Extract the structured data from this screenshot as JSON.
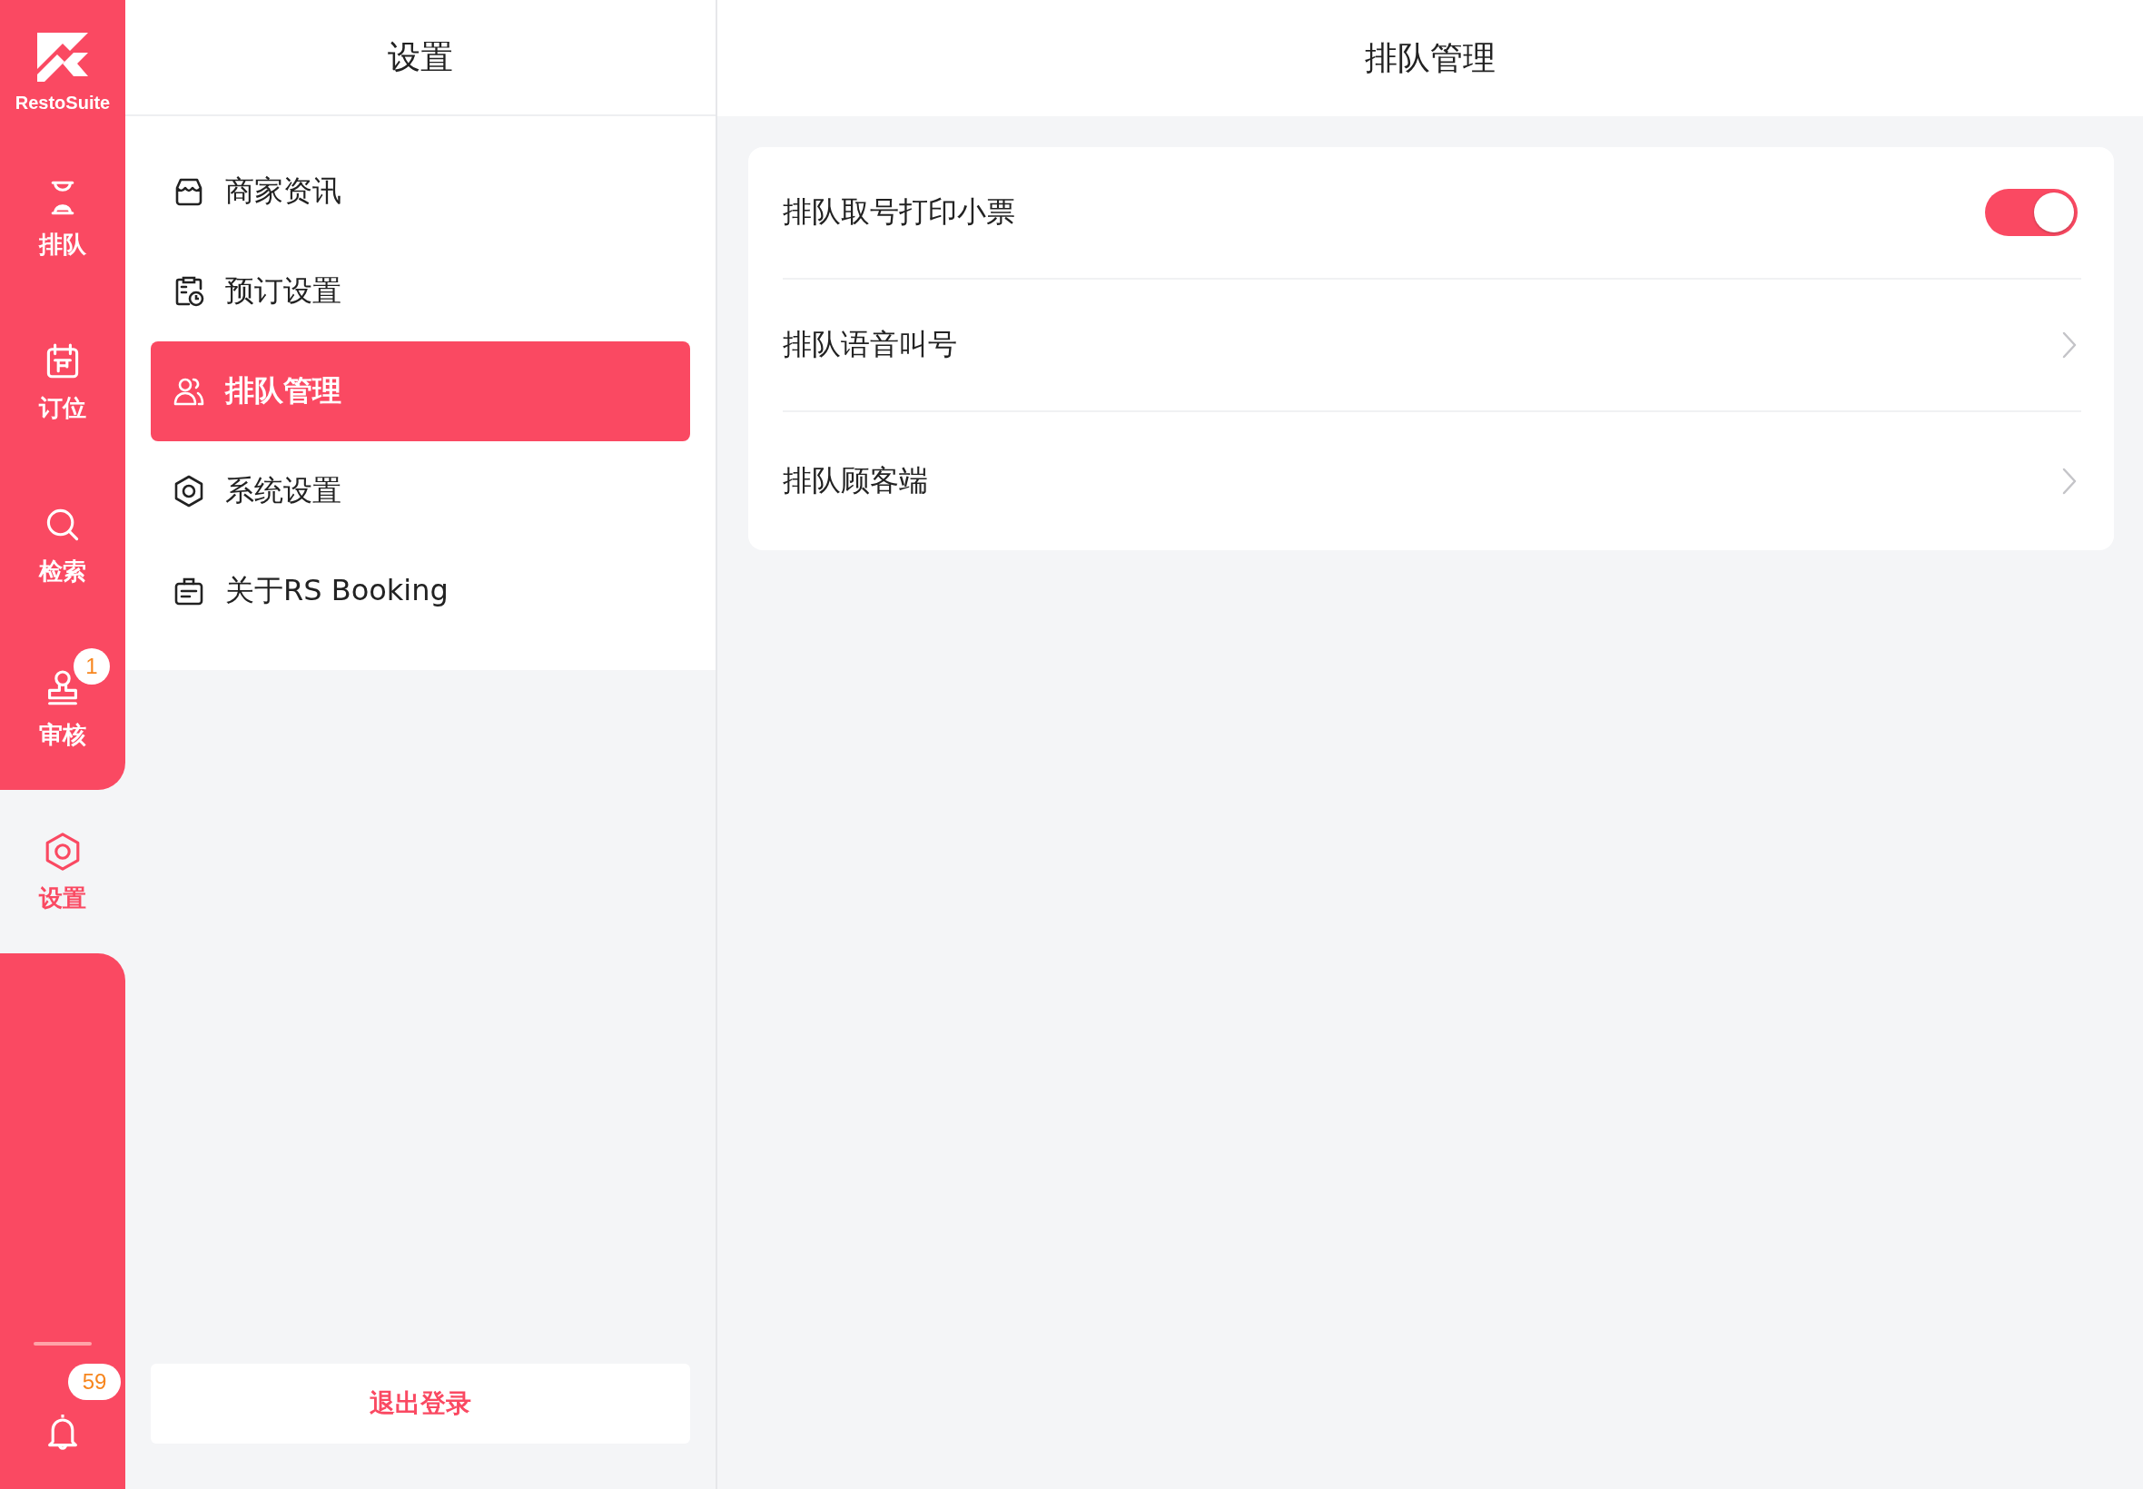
{
  "sidebar": {
    "logo_text": "RestoSuite",
    "items": [
      {
        "label": "排队",
        "selected": false
      },
      {
        "label": "订位",
        "selected": false
      },
      {
        "label": "检索",
        "selected": false
      },
      {
        "label": "审核",
        "selected": false,
        "badge": "1"
      },
      {
        "label": "设置",
        "selected": true
      }
    ],
    "notifications": {
      "badge": "59"
    }
  },
  "settings_menu": {
    "title": "设置",
    "items": [
      {
        "label": "商家资讯",
        "selected": false
      },
      {
        "label": "预订设置",
        "selected": false
      },
      {
        "label": "排队管理",
        "selected": true
      },
      {
        "label": "系统设置",
        "selected": false
      },
      {
        "label": "关于RS Booking",
        "selected": false
      }
    ],
    "logout": "退出登录"
  },
  "detail": {
    "title": "排队管理",
    "rows": [
      {
        "kind": "toggle",
        "label": "排队取号打印小票",
        "on": true
      },
      {
        "kind": "link",
        "label": "排队语音叫号"
      },
      {
        "kind": "link",
        "label": "排队顾客端"
      }
    ]
  }
}
